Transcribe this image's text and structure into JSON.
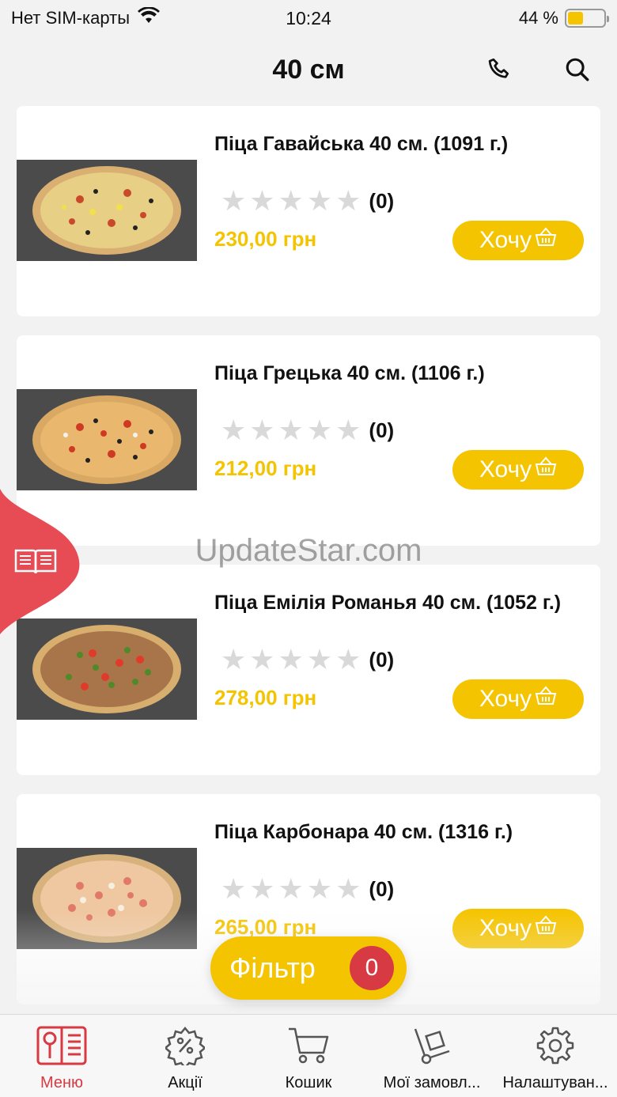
{
  "status_bar": {
    "carrier": "Нет SIM-карты",
    "time": "10:24",
    "battery": "44 %",
    "battery_level": 0.44
  },
  "header": {
    "title": "40 см",
    "phone_icon": "phone-icon",
    "search_icon": "search-icon"
  },
  "products": [
    {
      "title": "Піца Гавайська 40 см. (1091 г.)",
      "rating_count": "(0)",
      "price": "230,00 грн",
      "button": "Хочу",
      "rating": 0
    },
    {
      "title": "Піца Грецька 40 см. (1106 г.)",
      "rating_count": "(0)",
      "price": "212,00 грн",
      "button": "Хочу",
      "rating": 0
    },
    {
      "title": "Піца Емілія Романья 40 см. (1052 г.)",
      "rating_count": "(0)",
      "price": "278,00 грн",
      "button": "Хочу",
      "rating": 0
    },
    {
      "title": "Піца Карбонара 40 см. (1316 г.)",
      "rating_count": "(0)",
      "price": "265,00 грн",
      "button": "Хочу",
      "rating": 0
    }
  ],
  "watermark": "UpdateStar.com",
  "filter": {
    "label": "Фільтр",
    "count": "0"
  },
  "tabs": [
    {
      "label": "Меню",
      "icon": "menu-book-icon"
    },
    {
      "label": "Акції",
      "icon": "discount-gear-icon"
    },
    {
      "label": "Кошик",
      "icon": "cart-icon"
    },
    {
      "label": "Мої замовл...",
      "icon": "hand-truck-icon"
    },
    {
      "label": "Налаштуван...",
      "icon": "settings-icon"
    }
  ],
  "colors": {
    "accent": "#f5c400",
    "active_tab": "#d73a42",
    "background": "#f2f2f2"
  }
}
